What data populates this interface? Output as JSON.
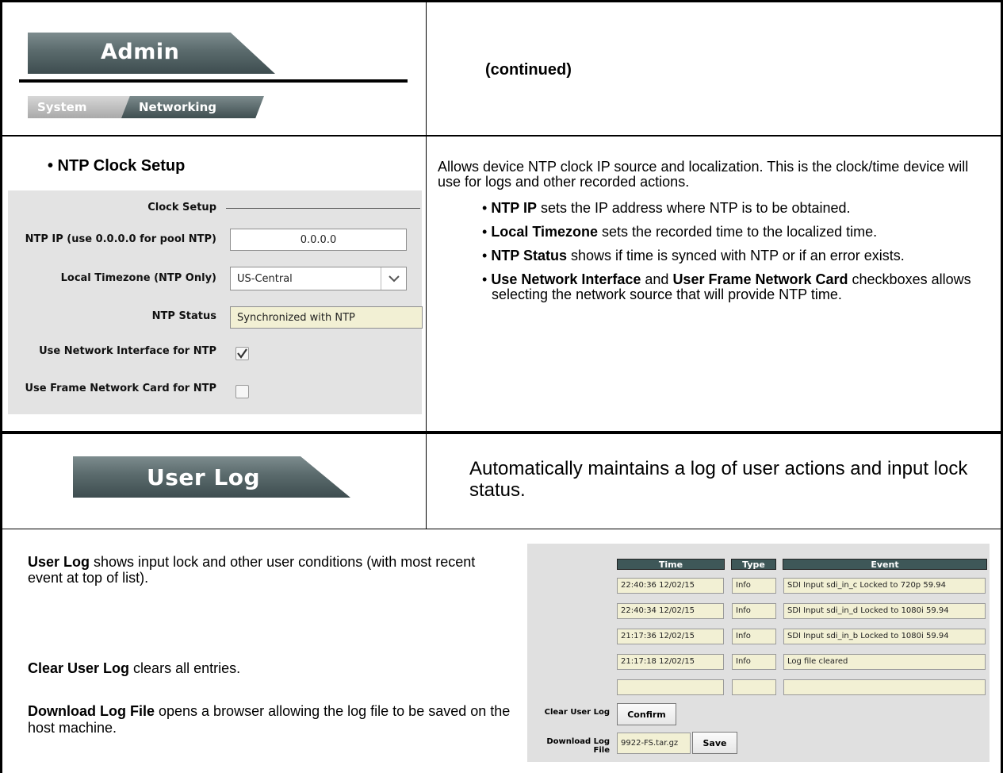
{
  "admin_tab": {
    "title": "Admin",
    "subtabs": [
      "System",
      "Networking"
    ]
  },
  "continued_label": "(continued)",
  "ntp_section": {
    "heading": "• NTP Clock Setup",
    "panel_title": "Clock Setup",
    "fields": [
      {
        "label": "NTP IP (use 0.0.0.0 for pool NTP)",
        "value": "0.0.0.0"
      },
      {
        "label": "Local Timezone (NTP Only)",
        "value": "US-Central"
      },
      {
        "label": "NTP Status",
        "value": "Synchronized with NTP"
      },
      {
        "label": "Use Network Interface for NTP",
        "checked": true
      },
      {
        "label": "Use Frame Network Card for NTP",
        "checked": false
      }
    ],
    "description": "Allows device NTP clock IP source and localization. This is the clock/time device will use for logs and other recorded actions.",
    "bullets": [
      {
        "bold": "NTP IP",
        "text": " sets the IP address where NTP is to be obtained."
      },
      {
        "bold": "Local Timezone",
        "text": " sets the recorded time to the localized time."
      },
      {
        "bold": "NTP Status",
        "text": " shows if time is synced with NTP or if an error exists."
      },
      {
        "bold": "Use Network Interface",
        "text": " and ",
        "bold2": "User Frame Network Card",
        "text2": " checkboxes allows selecting the network source that will provide NTP time."
      }
    ]
  },
  "user_log_tab": {
    "title": "User Log",
    "description": "Automatically maintains a log of user actions and input lock status."
  },
  "user_log_section": {
    "p1_bold": "User Log",
    "p1_text": " shows input lock and other user conditions (with most recent event at top of list).",
    "p2_bold": "Clear User Log",
    "p2_text": " clears all entries.",
    "p3_bold": "Download Log File",
    "p3_text": " opens a browser allowing the log file to be saved on the host machine.",
    "columns": [
      "Time",
      "Type",
      "Event"
    ],
    "rows": [
      [
        "22:40:36 12/02/15",
        "Info",
        "SDI Input sdi_in_c Locked to 720p 59.94"
      ],
      [
        "22:40:34 12/02/15",
        "Info",
        "SDI Input sdi_in_d Locked to 1080i 59.94"
      ],
      [
        "21:17:36 12/02/15",
        "Info",
        "SDI Input sdi_in_b Locked to 1080i 59.94"
      ],
      [
        "21:17:18 12/02/15",
        "Info",
        "Log file cleared"
      ],
      [
        "",
        "",
        ""
      ]
    ],
    "clear_label": "Clear User Log",
    "confirm_button": "Confirm",
    "download_label": "Download Log File",
    "file_name": "9922-FS.tar.gz",
    "save_button": "Save"
  }
}
